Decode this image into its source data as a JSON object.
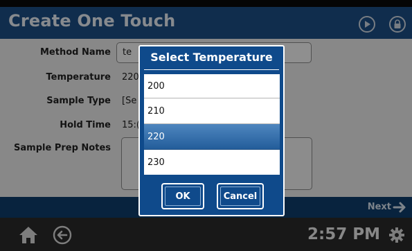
{
  "header": {
    "title": "Create One Touch",
    "icons": [
      "play-icon",
      "lock-icon"
    ]
  },
  "form": {
    "method_name_label": "Method Name",
    "method_name_value": "te",
    "temperature_label": "Temperature",
    "temperature_value": "220",
    "sample_type_label": "Sample Type",
    "sample_type_value": "[Se",
    "hold_time_label": "Hold Time",
    "hold_time_value": "15:(",
    "notes_label": "Sample Prep Notes"
  },
  "nav": {
    "next_label": "Next"
  },
  "footer": {
    "time": "2:57 PM",
    "icons": [
      "home-icon",
      "back-icon",
      "settings-icon"
    ]
  },
  "modal": {
    "title": "Select Temperature",
    "options": [
      "200",
      "210",
      "220",
      "230"
    ],
    "selected": "220",
    "ok_label": "OK",
    "cancel_label": "Cancel"
  },
  "colors": {
    "titlebar": "#1d4f86",
    "modal_bg": "#0f4a8b",
    "selected_row": "#2f6aa6",
    "form_bg": "#eaeaea"
  }
}
